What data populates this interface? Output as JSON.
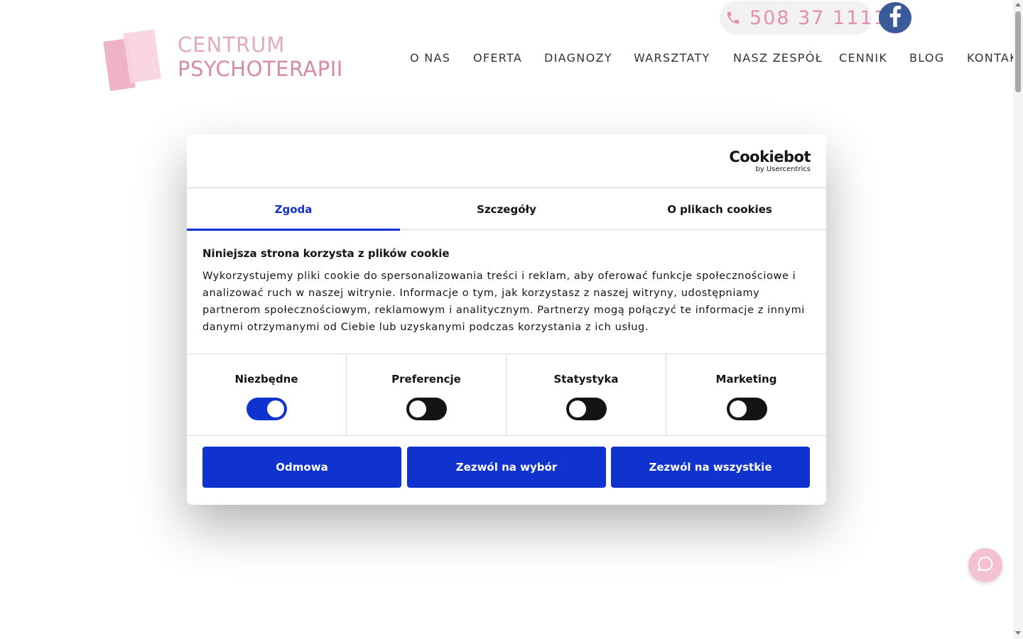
{
  "site": {
    "logo_line1": "CENTRUM",
    "logo_line2": "PSYCHOTERAPII",
    "phone": "508 37 1111",
    "nav": [
      "O NAS",
      "OFERTA",
      "DIAGNOZY",
      "WARSZTATY",
      "NASZ ZESPÓŁ",
      "CENNIK",
      "BLOG",
      "KONTAKT"
    ]
  },
  "cookie": {
    "brand": "Cookiebot",
    "brand_sub": "by Usercentrics",
    "tabs": [
      "Zgoda",
      "Szczegóły",
      "O plikach cookies"
    ],
    "active_tab": "Zgoda",
    "title": "Niniejsza strona korzysta z plików cookie",
    "text": "Wykorzystujemy pliki cookie do spersonalizowania treści i reklam, aby oferować funkcje społecznościowe i analizować ruch w naszej witrynie. Informacje o tym, jak korzystasz z naszej witryny, udostępniamy partnerom społecznościowym, reklamowym i analitycznym. Partnerzy mogą połączyć te informacje z innymi danymi otrzymanymi od Ciebie lub uzyskanymi podczas korzystania z ich usług.",
    "toggles": [
      {
        "label": "Niezbędne",
        "on": true
      },
      {
        "label": "Preferencje",
        "on": false
      },
      {
        "label": "Statystyka",
        "on": false
      },
      {
        "label": "Marketing",
        "on": false
      }
    ],
    "buttons": [
      "Odmowa",
      "Zezwól na wybór",
      "Zezwól na wszystkie"
    ]
  },
  "colors": {
    "accent_blue": "#1032cf",
    "brand_pink": "#e48fb0",
    "facebook_blue": "#3b5a9a",
    "chat_pink": "#f4c1d3"
  },
  "icons": {
    "phone": "phone-icon",
    "facebook": "facebook-icon",
    "chat": "chat-bubble-icon"
  }
}
